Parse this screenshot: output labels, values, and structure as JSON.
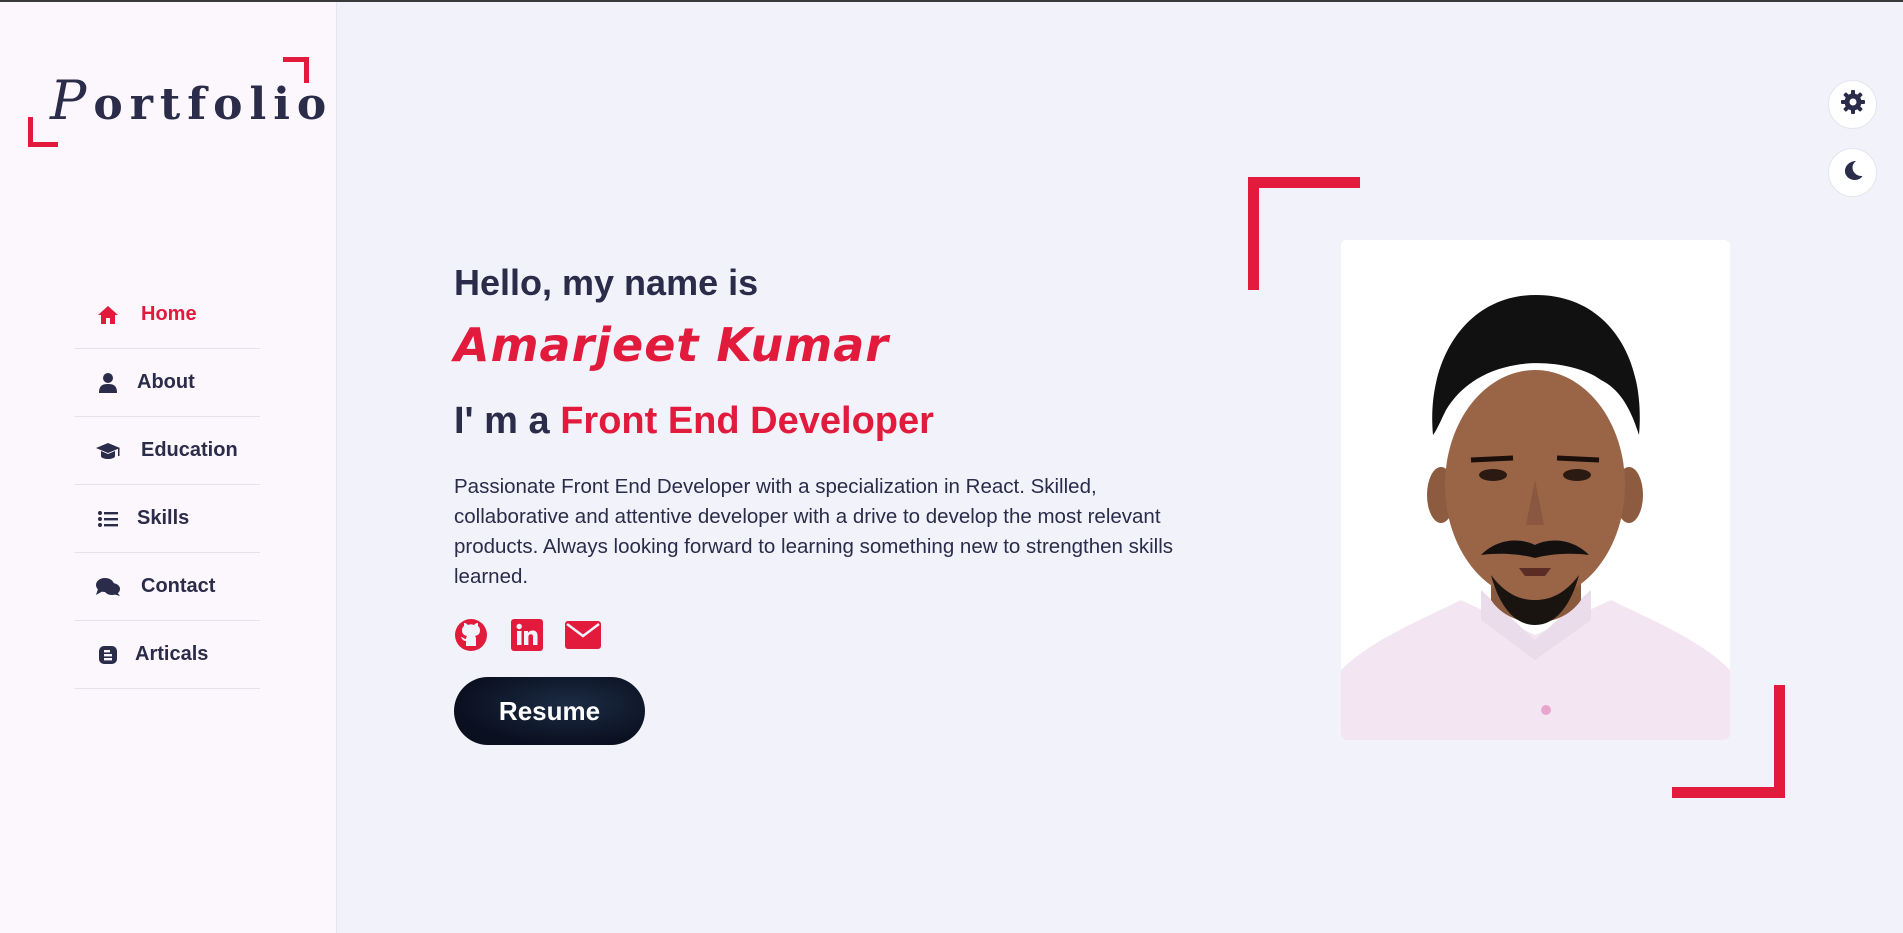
{
  "logo": {
    "first": "P",
    "rest": "ortfolio"
  },
  "nav": {
    "items": [
      {
        "label": "Home",
        "icon": "home-icon",
        "active": true
      },
      {
        "label": "About",
        "icon": "user-icon"
      },
      {
        "label": "Education",
        "icon": "graduation-cap-icon"
      },
      {
        "label": "Skills",
        "icon": "list-icon"
      },
      {
        "label": "Contact",
        "icon": "comments-icon"
      },
      {
        "label": "Articals",
        "icon": "blog-icon"
      }
    ]
  },
  "hero": {
    "greeting": "Hello, my name is",
    "name": "Amarjeet  Kumar",
    "role_prefix": "I' m a ",
    "role": "Front End Developer",
    "description": "Passionate Front End Developer with a specialization in React. Skilled, collaborative and attentive developer with a drive to develop the most relevant products. Always looking forward to learning something new to strengthen skills learned.",
    "socials": [
      "github-icon",
      "linkedin-icon",
      "envelope-icon"
    ],
    "resume_label": "Resume"
  },
  "tools": {
    "settings": "gear-icon",
    "theme": "moon-icon"
  },
  "colors": {
    "accent": "#e21b3c",
    "text": "#2b2b4a",
    "bg": "#f2f2fa",
    "sidebar": "#fbf7fc"
  }
}
